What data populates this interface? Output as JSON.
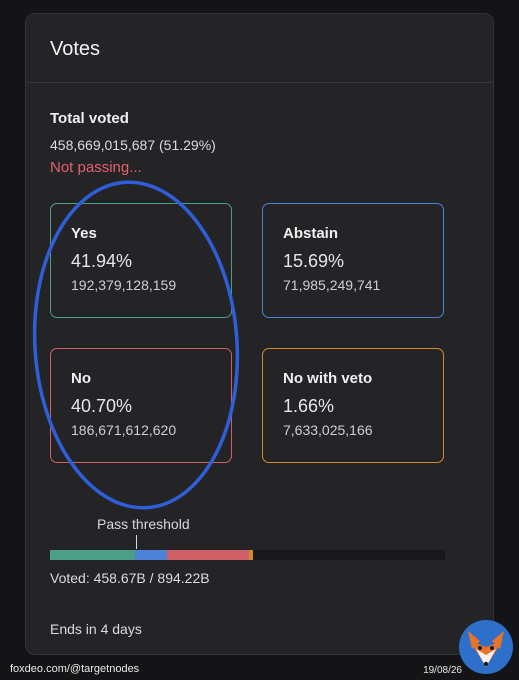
{
  "card": {
    "title": "Votes",
    "total_label": "Total voted",
    "total_value": "458,669,015,687 (51.29%)",
    "status": "Not passing...",
    "status_color": "#e2626a"
  },
  "options": [
    {
      "label": "Yes",
      "percent": "41.94%",
      "count": "192,379,128,159",
      "color": "#4a9f86"
    },
    {
      "label": "Abstain",
      "percent": "15.69%",
      "count": "71,985,249,741",
      "color": "#4e82d6"
    },
    {
      "label": "No",
      "percent": "40.70%",
      "count": "186,671,612,620",
      "color": "#d06068"
    },
    {
      "label": "No with veto",
      "percent": "1.66%",
      "count": "7,633,025,166",
      "color": "#d08a2e"
    }
  ],
  "threshold": {
    "label": "Pass threshold",
    "value_fraction_of_total_supply": 0.2
  },
  "progress": {
    "segments": [
      {
        "name": "yes",
        "share_of_total_supply": 0.2151,
        "color": "#4a9f86"
      },
      {
        "name": "abstain",
        "share_of_total_supply": 0.0805,
        "color": "#4e82d6"
      },
      {
        "name": "no",
        "share_of_total_supply": 0.2088,
        "color": "#d06068"
      },
      {
        "name": "no_with_veto",
        "share_of_total_supply": 0.0085,
        "color": "#d08a2e"
      }
    ],
    "voted_text": "Voted: 458.67B / 894.22B"
  },
  "ends_text": "Ends in 4 days",
  "annotation_color": "#2f5fd8",
  "footer": {
    "source": "foxdeo.com/@targetnodes",
    "date": "19/08/26"
  }
}
